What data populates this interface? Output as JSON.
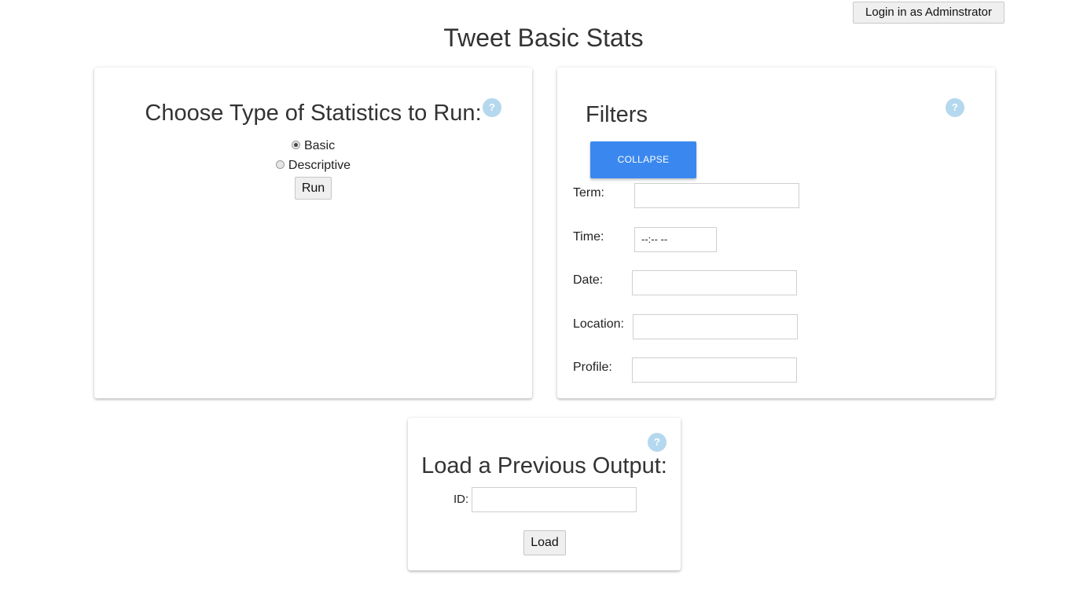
{
  "header": {
    "admin_button_label": "Login in as Adminstrator",
    "title": "Tweet Basic Stats"
  },
  "stats_panel": {
    "title": "Choose Type of Statistics to Run:",
    "help_icon": "?",
    "options": [
      {
        "label": "Basic",
        "selected": true
      },
      {
        "label": "Descriptive",
        "selected": false
      }
    ],
    "run_label": "Run"
  },
  "filters_panel": {
    "title": "Filters",
    "help_icon": "?",
    "collapse_label": "COLLAPSE",
    "fields": {
      "term": {
        "label": "Term:",
        "value": ""
      },
      "time": {
        "label": "Time:",
        "value": "--:-- --"
      },
      "date": {
        "label": "Date:",
        "value": ""
      },
      "location": {
        "label": "Location:",
        "value": ""
      },
      "profile": {
        "label": "Profile:",
        "value": ""
      }
    }
  },
  "load_panel": {
    "title": "Load a Previous Output:",
    "help_icon": "?",
    "id_label": "ID:",
    "id_value": "",
    "load_label": "Load"
  },
  "colors": {
    "accent": "#3a88ef",
    "help_icon": "#b4d8ee"
  }
}
